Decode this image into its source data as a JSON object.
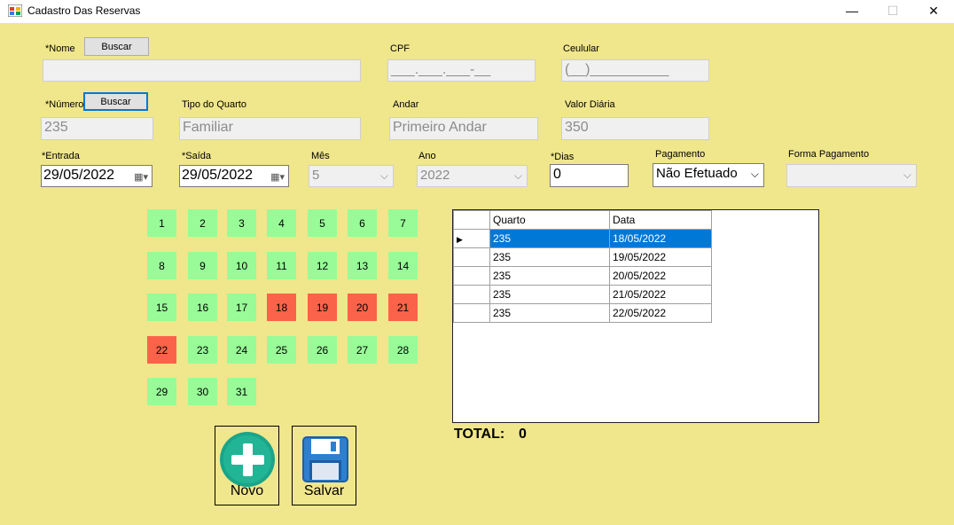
{
  "window": {
    "title": "Cadastro Das Reservas",
    "controls": [
      "minimize",
      "maximize",
      "close"
    ],
    "icons": {
      "minimize": "—",
      "maximize": "☐",
      "close": "✕"
    }
  },
  "form": {
    "nome_label": "*Nome",
    "nome_buscar": "Buscar",
    "nome_value": "",
    "cpf_label": "CPF",
    "cpf_value": "___.___.___-__",
    "celular_label": "Ceulular",
    "celular_value": "(__)__________",
    "numero_label": "*Número",
    "numero_buscar": "Buscar",
    "numero_value": "235",
    "tipo_label": "Tipo do Quarto",
    "tipo_value": "Familiar",
    "andar_label": "Andar",
    "andar_value": "Primeiro Andar",
    "valor_label": "Valor Diária",
    "valor_value": "350",
    "entrada_label": "*Entrada",
    "entrada_value": "29/05/2022",
    "saida_label": "*Saída",
    "saida_value": "29/05/2022",
    "mes_label": "Mês",
    "mes_value": "5",
    "ano_label": "Ano",
    "ano_value": "2022",
    "dias_label": "*Dias",
    "dias_value": "0",
    "pagamento_label": "Pagamento",
    "pagamento_value": "Não Efetuado",
    "forma_label": "Forma Pagamento",
    "forma_value": ""
  },
  "calendar": {
    "days": [
      "1",
      "2",
      "3",
      "4",
      "5",
      "6",
      "7",
      "8",
      "9",
      "10",
      "11",
      "12",
      "13",
      "14",
      "15",
      "16",
      "17",
      "18",
      "19",
      "20",
      "21",
      "22",
      "23",
      "24",
      "25",
      "26",
      "27",
      "28",
      "29",
      "30",
      "31"
    ],
    "reserved": [
      "18",
      "19",
      "20",
      "21",
      "22"
    ],
    "colors": {
      "free": "#98fb98",
      "reserved": "#fa6349"
    }
  },
  "grid": {
    "headers": [
      "Quarto",
      "Data"
    ],
    "rows": [
      [
        "235",
        "18/05/2022"
      ],
      [
        "235",
        "19/05/2022"
      ],
      [
        "235",
        "20/05/2022"
      ],
      [
        "235",
        "21/05/2022"
      ],
      [
        "235",
        "22/05/2022"
      ]
    ],
    "selected_row": 0
  },
  "total": {
    "label": "TOTAL:",
    "value": "0"
  },
  "actions": {
    "novo_label": "Novo",
    "salvar_label": "Salvar"
  },
  "colors": {
    "form_bg": "#f0e68c",
    "selection": "#0078d7",
    "novo_icon": "#1aa58a",
    "salvar_icon": "#2f7fd0"
  }
}
